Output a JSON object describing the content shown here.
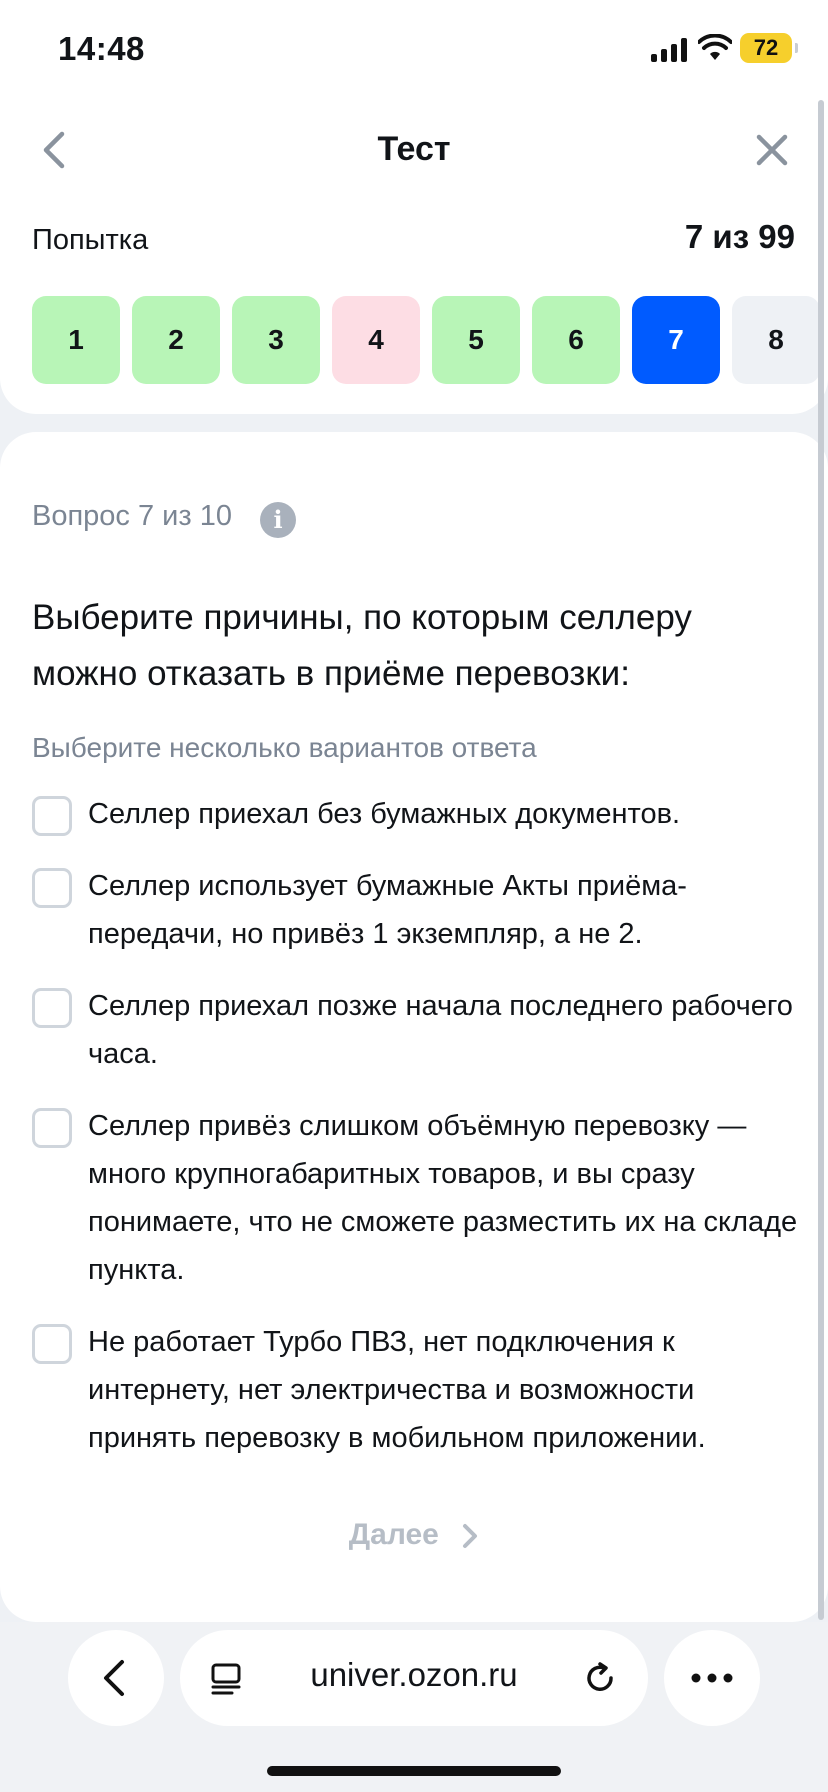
{
  "status": {
    "time": "14:48",
    "battery": "72"
  },
  "header": {
    "title": "Тест",
    "attempt_label": "Попытка",
    "attempt_value": "7 из 99"
  },
  "attempts": [
    {
      "n": "1",
      "state": "correct"
    },
    {
      "n": "2",
      "state": "correct"
    },
    {
      "n": "3",
      "state": "correct"
    },
    {
      "n": "4",
      "state": "wrong"
    },
    {
      "n": "5",
      "state": "correct"
    },
    {
      "n": "6",
      "state": "correct"
    },
    {
      "n": "7",
      "state": "current"
    },
    {
      "n": "8",
      "state": "pending"
    }
  ],
  "question": {
    "number_label": "Вопрос 7 из 10",
    "text": "Выберите причины, по которым селлеру можно отказать в приёме перевозки:",
    "hint": "Выберите несколько вариантов ответа",
    "options": [
      {
        "text": "Селлер приехал без бумажных документов.",
        "checked": false
      },
      {
        "text": "Селлер использует бумажные Акты приёма-передачи, но привёз 1 экземпляр, а не 2.",
        "checked": false
      },
      {
        "text": "Селлер приехал позже начала последнего рабочего часа.",
        "checked": false
      },
      {
        "text": "Селлер привёз слишком объёмную перевозку — много крупногабаритных товаров, и вы сразу понимаете, что не сможете разместить их на складе пункта.",
        "checked": false
      },
      {
        "text": "Не работает Турбо ПВЗ, нет подключения к интернету, нет электричества и возможности принять перевозку в мобильном приложении.",
        "checked": false
      }
    ],
    "next_label": "Далее"
  },
  "browser": {
    "url": "univer.ozon.ru"
  },
  "colors": {
    "accent": "#005bff",
    "correct": "#b8f5b7",
    "wrong": "#fddde4",
    "pending": "#eef1f5",
    "muted": "#7b8593"
  }
}
